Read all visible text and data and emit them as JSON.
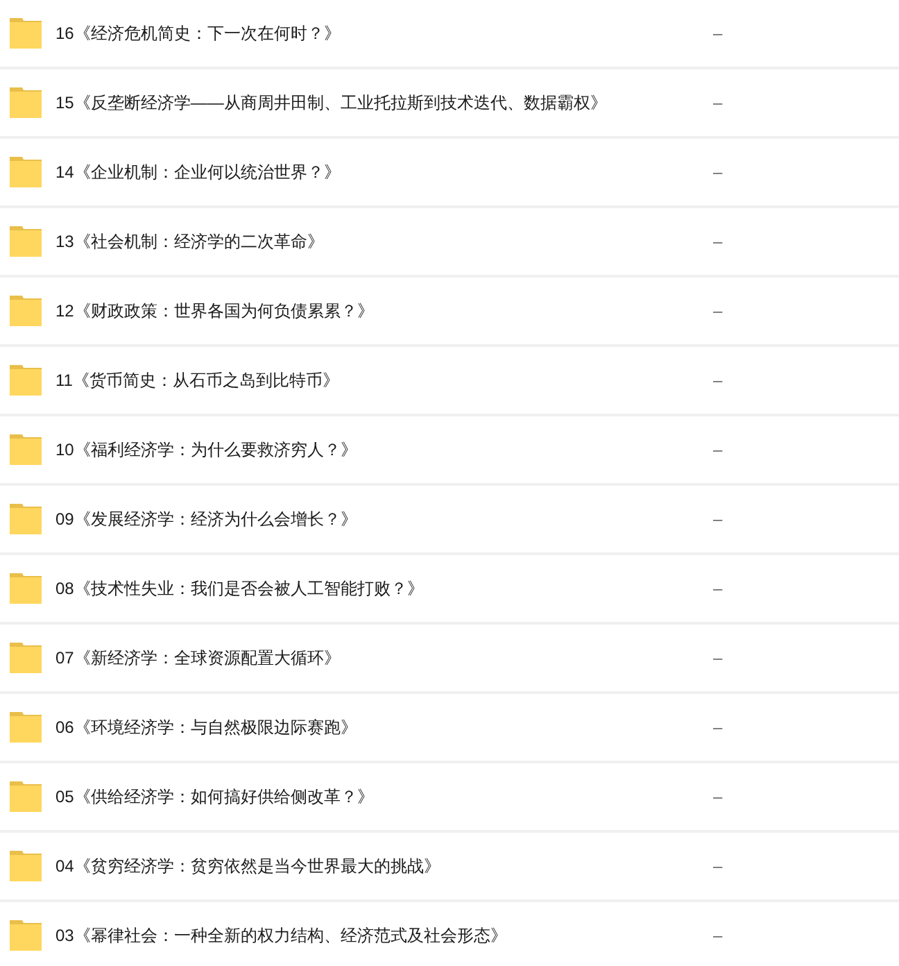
{
  "files": [
    {
      "name": "16《经济危机简史：下一次在何时？》",
      "column_2": "–"
    },
    {
      "name": "15《反垄断经济学——从商周井田制、工业托拉斯到技术迭代、数据霸权》",
      "column_2": "–"
    },
    {
      "name": "14《企业机制：企业何以统治世界？》",
      "column_2": "–"
    },
    {
      "name": "13《社会机制：经济学的二次革命》",
      "column_2": "–"
    },
    {
      "name": "12《财政政策：世界各国为何负债累累？》",
      "column_2": "–"
    },
    {
      "name": "11《货币简史：从石币之岛到比特币》",
      "column_2": "–"
    },
    {
      "name": "10《福利经济学：为什么要救济穷人？》",
      "column_2": "–"
    },
    {
      "name": "09《发展经济学：经济为什么会增长？》",
      "column_2": "–"
    },
    {
      "name": "08《技术性失业：我们是否会被人工智能打败？》",
      "column_2": "–"
    },
    {
      "name": "07《新经济学：全球资源配置大循环》",
      "column_2": "–"
    },
    {
      "name": "06《环境经济学：与自然极限边际赛跑》",
      "column_2": "–"
    },
    {
      "name": "05《供给经济学：如何搞好供给侧改革？》",
      "column_2": "–"
    },
    {
      "name": "04《贫穷经济学：贫穷依然是当今世界最大的挑战》",
      "column_2": "–"
    },
    {
      "name": "03《幂律社会：一种全新的权力结构、经济范式及社会形态》",
      "column_2": "–"
    }
  ]
}
